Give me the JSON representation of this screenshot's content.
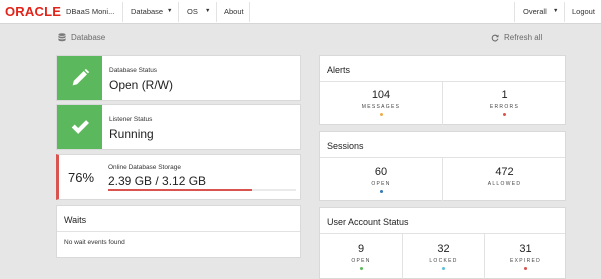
{
  "nav": {
    "logo": "ORACLE",
    "app_title": "DBaaS Moni...",
    "items": [
      {
        "label": "Database",
        "caret": "▼"
      },
      {
        "label": "OS",
        "caret": "▼"
      },
      {
        "label": "About"
      }
    ],
    "right": [
      {
        "label": "Overall",
        "caret": "▼"
      },
      {
        "label": "Logout"
      }
    ]
  },
  "subheader": {
    "crumb": "Database",
    "refresh": "Refresh all"
  },
  "database_status": {
    "label": "Database Status",
    "value": "Open (R/W)"
  },
  "listener_status": {
    "label": "Listener Status",
    "value": "Running"
  },
  "storage": {
    "percent_text": "76%",
    "label": "Online Database Storage",
    "value": "2.39 GB / 3.12 GB",
    "fill_fraction": 0.766,
    "color": "#d9534f"
  },
  "waits": {
    "title": "Waits",
    "empty": "No wait events found"
  },
  "alerts": {
    "title": "Alerts",
    "metrics": [
      {
        "value": "104",
        "caption": "MESSAGES",
        "dot_color": "#f0ad4e"
      },
      {
        "value": "1",
        "caption": "ERRORS",
        "dot_color": "#d9534f"
      }
    ]
  },
  "sessions": {
    "title": "Sessions",
    "metrics": [
      {
        "value": "60",
        "caption": "OPEN",
        "dot_color": "#337ab7"
      },
      {
        "value": "472",
        "caption": "ALLOWED",
        "dot_color": ""
      }
    ]
  },
  "user_account_status": {
    "title": "User Account Status",
    "metrics": [
      {
        "value": "9",
        "caption": "OPEN",
        "dot_color": "#5cb85c"
      },
      {
        "value": "32",
        "caption": "LOCKED",
        "dot_color": "#5bc0de"
      },
      {
        "value": "31",
        "caption": "EXPIRED",
        "dot_color": "#d9534f"
      }
    ]
  },
  "colors": {
    "ok_tile": "#5cb85c",
    "danger": "#d9534f",
    "background": "#e6e6e6"
  },
  "icons": {
    "database_status": "pencil-icon",
    "listener_status": "checkmark-icon",
    "crumb": "database-icon",
    "refresh": "refresh-icon"
  }
}
